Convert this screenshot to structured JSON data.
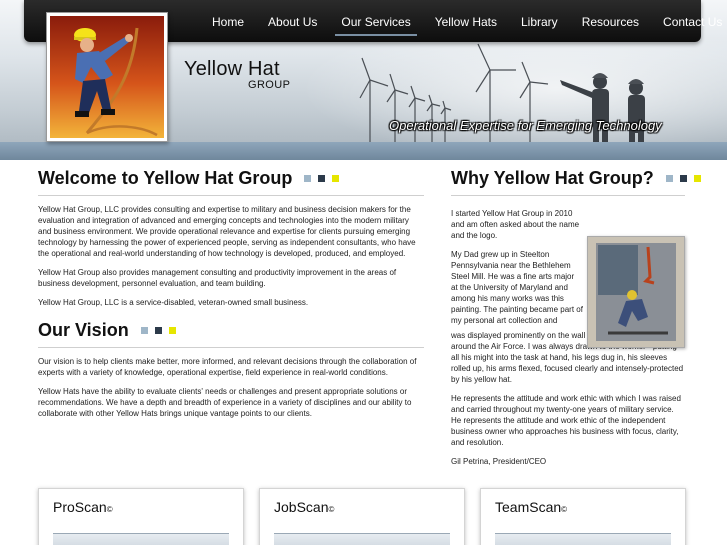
{
  "nav": {
    "items": [
      "Home",
      "About Us",
      "Our Services",
      "Yellow Hats",
      "Library",
      "Resources",
      "Contact Us"
    ],
    "active": "Our Services"
  },
  "brand": {
    "name": "Yellow Hat",
    "sub": "GROUP"
  },
  "tagline": "Operational Expertise for Emerging Technology",
  "welcome": {
    "title": "Welcome to Yellow Hat Group",
    "paragraphs": [
      "Yellow Hat Group, LLC provides consulting and expertise to military and business decision makers for the evaluation and integration of advanced and emerging concepts and technologies into the modern military and business environment.  We provide operational relevance and expertise for clients pursuing emerging technology by harnessing the power of experienced people, serving as independent consultants, who have the operational and real-world understanding of how technology is developed, produced, and employed.",
      "Yellow Hat Group also provides management consulting and productivity improvement in the areas of business development, personnel evaluation, and team building.",
      "Yellow Hat Group, LLC is a service-disabled, veteran-owned small business."
    ]
  },
  "vision": {
    "title": "Our Vision",
    "paragraphs": [
      "Our vision is to help clients make better, more informed, and relevant decisions through the collaboration of experts with a variety of knowledge, operational expertise, field experience in real-world conditions.",
      "Yellow Hats have the ability to evaluate clients' needs or challenges and present appropriate solutions or recommendations.  We have a depth and breadth of experience in a variety of disciplines and our ability to collaborate with other Yellow Hats brings unique vantage points to our clients."
    ]
  },
  "why": {
    "title": "Why Yellow Hat Group?",
    "p1": "I started Yellow Hat Group in 2010 and am often asked about the name and the logo.",
    "p2a": "My Dad grew up in Steelton Pennsylvania near the Bethlehem Steel Mill.  He was a fine arts major at the University of Maryland and among his many works was this painting.  The painting became part of my personal art collection and",
    "p2b": "was displayed prominently on the wall of my homes as I moved around the Air Force.  I was always drawn to the worker - putting all his might into the task at hand, his legs dug in, his sleeves rolled up, his arms flexed, focused clearly and intensely-protected by his yellow hat.",
    "p3": "He represents the attitude and work ethic with which I was raised and carried throughout my twenty-one years of military service.  He represents the attitude and work ethic of the independent business owner who approaches his business with focus, clarity, and resolution.",
    "signature": "Gil Petrina, President/CEO"
  },
  "cards": [
    {
      "title": "ProScan",
      "mark": "©"
    },
    {
      "title": "JobScan",
      "mark": "©"
    },
    {
      "title": "TeamScan",
      "mark": "©"
    }
  ],
  "colors": {
    "accent_light": "#9fb6c8",
    "accent_dark": "#2c3a4a",
    "accent_yellow": "#e6e600",
    "nav_bg": "#111111"
  }
}
